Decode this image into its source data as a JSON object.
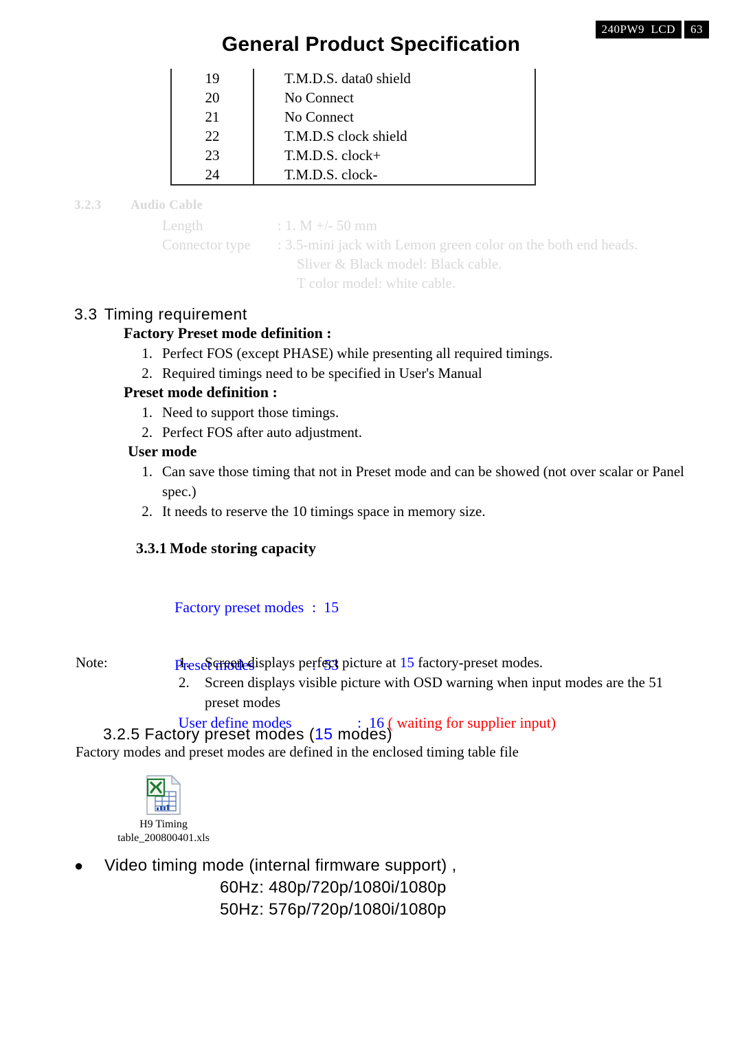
{
  "header": {
    "model_tag": "240PW9  LCD",
    "page_number": "63",
    "title": "General Product Specification"
  },
  "pin_table": {
    "rows": [
      {
        "pin": "19",
        "desc": "T.M.D.S. data0 shield"
      },
      {
        "pin": "20",
        "desc": "No Connect"
      },
      {
        "pin": "21",
        "desc": "No Connect"
      },
      {
        "pin": "22",
        "desc": "T.M.D.S clock shield"
      },
      {
        "pin": "23",
        "desc": "T.M.D.S. clock+"
      },
      {
        "pin": "24",
        "desc": "T.M.D.S. clock-"
      }
    ]
  },
  "audio_cable": {
    "number": "3.2.3",
    "heading": "Audio Cable",
    "length_label": "Length",
    "length_value": ": 1.  M +/- 50 mm",
    "connector_label": "Connector type",
    "connector_value": ": 3.5-mini jack with Lemon green color on the both end heads.",
    "connector_line2": "Sliver & Black model: Black cable.",
    "connector_line3": "T color model: white cable."
  },
  "timing": {
    "number": "3.3",
    "heading": "Timing requirement",
    "factory_preset_heading": "Factory Preset mode definition :",
    "factory_preset_items": [
      {
        "marker": "1.",
        "text": "Perfect FOS (except PHASE) while presenting all required timings."
      },
      {
        "marker": "2.",
        "text": "Required timings need to be specified in User's Manual"
      }
    ],
    "preset_heading": "Preset mode definition :",
    "preset_items": [
      {
        "marker": "1.",
        "text": "Need to support those timings."
      },
      {
        "marker": "2.",
        "text": "Perfect FOS after auto adjustment."
      }
    ],
    "user_heading": "User mode",
    "user_items": [
      {
        "marker": "1.",
        "text": "Can save those timing that not in Preset mode and can be showed (not over scalar or Panel spec.)"
      },
      {
        "marker": "2.",
        "text": "It needs to reserve the 10 timings space in memory size."
      }
    ]
  },
  "mode_storing": {
    "number": "3.3.1",
    "heading": "Mode storing capacity",
    "factory_label": "Factory preset modes",
    "factory_value": ":  15",
    "preset_label": "Preset modes",
    "preset_value": ":  53",
    "user_label": " User define modes",
    "user_value": ":  16 ",
    "user_note": "( waiting for supplier input)"
  },
  "note": {
    "label": "Note:",
    "items": [
      {
        "marker": "1.",
        "text_before": "Screen displays perfect picture at ",
        "highlight": "15",
        "text_after": " factory-preset modes."
      },
      {
        "marker": "2.",
        "text_before": "Screen displays visible picture with OSD warning when input modes are the 51 preset modes",
        "highlight": "",
        "text_after": ""
      }
    ]
  },
  "factory_preset_modes": {
    "number": "3.2.5",
    "heading_before": "Factory preset modes (",
    "count": "15",
    "heading_after": " modes)",
    "description": "Factory modes and preset modes are defined in the enclosed timing table file"
  },
  "attachment": {
    "icon": "excel-file-icon",
    "caption_line1": "H9 Timing",
    "caption_line2": "table_200800401.xls"
  },
  "video_timing": {
    "bullet": "●",
    "heading": "Video timing mode (internal firmware support) ,",
    "line_60hz": "60Hz: 480p/720p/1080i/1080p",
    "line_50hz": "50Hz: 576p/720p/1080i/1080p"
  },
  "colors": {
    "blue": "#0000ff",
    "red": "#ff0000",
    "faded_gray": "#d9d9d9",
    "rule": "#2a2a2a"
  }
}
